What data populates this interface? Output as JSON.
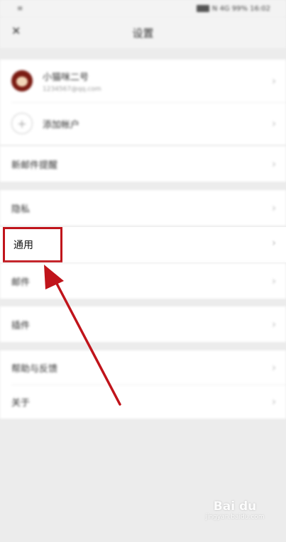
{
  "status_bar": {
    "left": "≡",
    "right": "N 4G 99% 16:02"
  },
  "header": {
    "back_icon": "✕",
    "title": "设置"
  },
  "accounts": [
    {
      "name": "小猫咪二号",
      "email": "1234567@qq.com",
      "avatar": "qq-avatar-icon"
    },
    {
      "name": "添加帐户",
      "icon": "plus-icon"
    }
  ],
  "menu": {
    "new_mail_alert": "新邮件提醒",
    "privacy": "隐私",
    "general": "通用",
    "mailbox": "邮件",
    "plugins": "插件",
    "help": "帮助与反馈",
    "about": "关于"
  },
  "chevron": "›",
  "watermark": {
    "logo": "Bai du",
    "sub": "jingyan.baidu.com"
  },
  "colors": {
    "highlight": "#c0141b",
    "background": "#ececec"
  }
}
